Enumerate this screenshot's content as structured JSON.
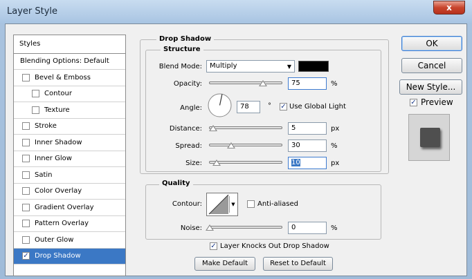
{
  "window": {
    "title": "Layer Style",
    "close_glyph": "x"
  },
  "styles_panel": {
    "header": "Styles",
    "items": [
      {
        "label": "Blending Options: Default",
        "checkbox": false
      },
      {
        "label": "Bevel & Emboss",
        "checkbox": true,
        "checked": false
      },
      {
        "label": "Contour",
        "checkbox": true,
        "checked": false,
        "indent": true
      },
      {
        "label": "Texture",
        "checkbox": true,
        "checked": false,
        "indent": true
      },
      {
        "label": "Stroke",
        "checkbox": true,
        "checked": false
      },
      {
        "label": "Inner Shadow",
        "checkbox": true,
        "checked": false
      },
      {
        "label": "Inner Glow",
        "checkbox": true,
        "checked": false
      },
      {
        "label": "Satin",
        "checkbox": true,
        "checked": false
      },
      {
        "label": "Color Overlay",
        "checkbox": true,
        "checked": false
      },
      {
        "label": "Gradient Overlay",
        "checkbox": true,
        "checked": false
      },
      {
        "label": "Pattern Overlay",
        "checkbox": true,
        "checked": false
      },
      {
        "label": "Outer Glow",
        "checkbox": true,
        "checked": false
      },
      {
        "label": "Drop Shadow",
        "checkbox": true,
        "checked": true,
        "selected": true
      }
    ]
  },
  "drop_shadow": {
    "title": "Drop Shadow",
    "structure_title": "Structure",
    "blend_mode_label": "Blend Mode:",
    "blend_mode_value": "Multiply",
    "shadow_color": "#000000",
    "opacity_label": "Opacity:",
    "opacity_value": "75",
    "opacity_unit": "%",
    "angle_label": "Angle:",
    "angle_value": "78",
    "angle_unit": "°",
    "use_global_light_label": "Use Global Light",
    "use_global_light_checked": true,
    "distance_label": "Distance:",
    "distance_value": "5",
    "distance_unit": "px",
    "spread_label": "Spread:",
    "spread_value": "30",
    "spread_unit": "%",
    "size_label": "Size:",
    "size_value": "10",
    "size_unit": "px",
    "quality_title": "Quality",
    "contour_label": "Contour:",
    "anti_aliased_label": "Anti-aliased",
    "anti_aliased_checked": false,
    "noise_label": "Noise:",
    "noise_value": "0",
    "noise_unit": "%",
    "knockout_label": "Layer Knocks Out Drop Shadow",
    "knockout_checked": true,
    "make_default_label": "Make Default",
    "reset_default_label": "Reset to Default"
  },
  "actions": {
    "ok_label": "OK",
    "cancel_label": "Cancel",
    "new_style_label": "New Style...",
    "preview_label": "Preview",
    "preview_checked": true
  }
}
